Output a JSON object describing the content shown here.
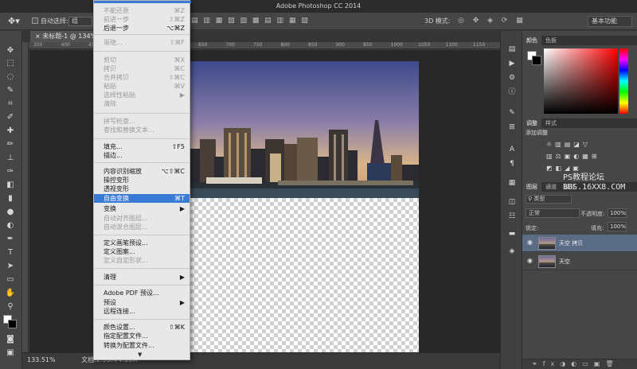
{
  "app": {
    "title": "Adobe Photoshop CC 2014"
  },
  "options_bar": {
    "tool_icon": "move-tool-icon",
    "auto_select_label": "自动选择:",
    "auto_select_value": "组",
    "mode_3d_label": "3D 模式:",
    "workspace": "基本功能"
  },
  "document": {
    "tab_title": "未标题-1 @ 134% (天空",
    "ruler_ticks": [
      "350",
      "400",
      "450",
      "500",
      "550",
      "600",
      "650",
      "700",
      "750",
      "800",
      "850",
      "900",
      "950",
      "1000",
      "1050",
      "1100",
      "1150"
    ],
    "zoom": "133.51%",
    "doc_size": "文档:2.93M/4.00M"
  },
  "panels": {
    "color_tabs": [
      "颜色",
      "色板"
    ],
    "adjust_tabs": [
      "调整",
      "样式"
    ],
    "adjust_title": "添加调整",
    "layer_tabs": [
      "图层",
      "通道",
      "路径"
    ],
    "layer_kind": "类型",
    "blend_mode": "正常",
    "opacity_label": "不透明度:",
    "opacity_value": "100%",
    "lock_label": "锁定:",
    "fill_label": "填充:",
    "fill_value": "100%",
    "layers": [
      {
        "name": "天空 拷贝",
        "active": true
      },
      {
        "name": "天空",
        "active": false
      }
    ]
  },
  "watermark": {
    "line1": "PS教程论坛",
    "line2": "BBS.16XX8.COM"
  },
  "edit_menu": {
    "items": [
      {
        "label": "不能还原",
        "shortcut": "⌘Z",
        "disabled": true
      },
      {
        "label": "前进一步",
        "shortcut": "⇧⌘Z",
        "disabled": true
      },
      {
        "label": "后退一步",
        "shortcut": "⌥⌘Z",
        "disabled": false
      },
      {
        "label": "渐隐...",
        "shortcut": "⇧⌘F",
        "disabled": true
      },
      {
        "label": "剪切",
        "shortcut": "⌘X",
        "disabled": true
      },
      {
        "label": "拷贝",
        "shortcut": "⌘C",
        "disabled": true
      },
      {
        "label": "合并拷贝",
        "shortcut": "⇧⌘C",
        "disabled": true
      },
      {
        "label": "粘贴",
        "shortcut": "⌘V",
        "disabled": true
      },
      {
        "label": "选择性粘贴",
        "shortcut": "▶",
        "disabled": true
      },
      {
        "label": "清除",
        "shortcut": "",
        "disabled": true
      },
      {
        "label": "拼写检查...",
        "shortcut": "",
        "disabled": true
      },
      {
        "label": "查找和替换文本...",
        "shortcut": "",
        "disabled": true
      },
      {
        "label": "填充...",
        "shortcut": "⇧F5",
        "disabled": false
      },
      {
        "label": "描边...",
        "shortcut": "",
        "disabled": false
      },
      {
        "label": "内容识别缩放",
        "shortcut": "⌥⇧⌘C",
        "disabled": false
      },
      {
        "label": "操控变形",
        "shortcut": "",
        "disabled": false
      },
      {
        "label": "透视变形",
        "shortcut": "",
        "disabled": false
      },
      {
        "label": "自由变换",
        "shortcut": "⌘T",
        "disabled": false,
        "highlighted": true
      },
      {
        "label": "变换",
        "shortcut": "▶",
        "disabled": false
      },
      {
        "label": "自动对齐图层...",
        "shortcut": "",
        "disabled": true
      },
      {
        "label": "自动混合图层...",
        "shortcut": "",
        "disabled": true
      },
      {
        "label": "定义画笔预设...",
        "shortcut": "",
        "disabled": false
      },
      {
        "label": "定义图案...",
        "shortcut": "",
        "disabled": false
      },
      {
        "label": "定义自定形状...",
        "shortcut": "",
        "disabled": true
      },
      {
        "label": "清理",
        "shortcut": "▶",
        "disabled": false
      },
      {
        "label": "Adobe PDF 预设...",
        "shortcut": "",
        "disabled": false
      },
      {
        "label": "预设",
        "shortcut": "▶",
        "disabled": false
      },
      {
        "label": "远程连接...",
        "shortcut": "",
        "disabled": false
      },
      {
        "label": "颜色设置...",
        "shortcut": "⇧⌘K",
        "disabled": false
      },
      {
        "label": "指定配置文件...",
        "shortcut": "",
        "disabled": false
      },
      {
        "label": "转换为配置文件...",
        "shortcut": "",
        "disabled": false
      }
    ],
    "more_indicator": "▼"
  }
}
